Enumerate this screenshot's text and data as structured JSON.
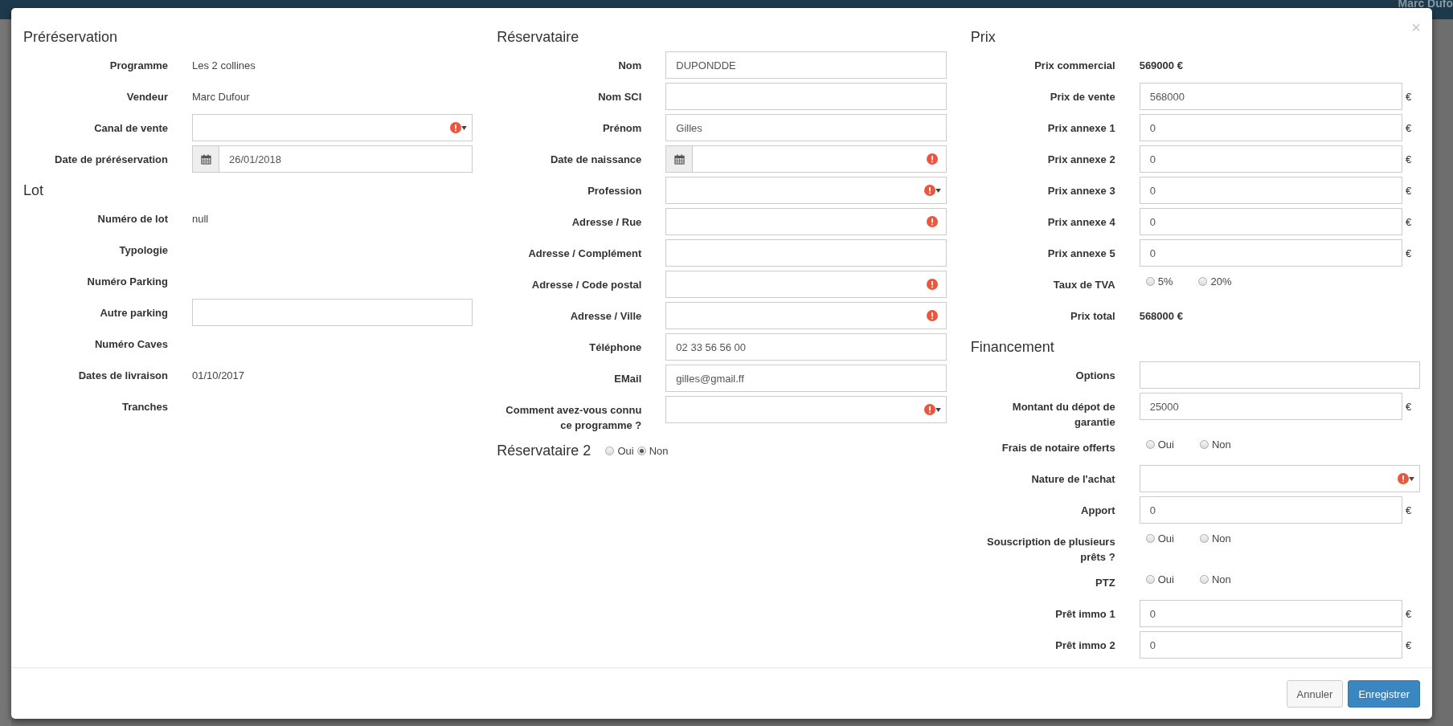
{
  "topbar": {
    "user": "Marc Dufo"
  },
  "modal": {
    "close": "×",
    "columns": [
      [
        {
          "title": "Préréservation",
          "rows": [
            {
              "kind": "static",
              "label": "Programme",
              "value": "Les 2 collines"
            },
            {
              "kind": "static",
              "label": "Vendeur",
              "value": "Marc Dufour"
            },
            {
              "kind": "select",
              "label": "Canal de vente",
              "error": true
            },
            {
              "kind": "date",
              "label": "Date de préréservation",
              "value": "26/01/2018",
              "error": false
            }
          ]
        },
        {
          "title": "Lot",
          "rows": [
            {
              "kind": "static",
              "label": "Numéro de lot",
              "value": "null"
            },
            {
              "kind": "static",
              "label": "Typologie"
            },
            {
              "kind": "static",
              "label": "Numéro Parking"
            },
            {
              "kind": "input",
              "label": "Autre parking",
              "error": false
            },
            {
              "kind": "static",
              "label": "Numéro Caves"
            },
            {
              "kind": "static",
              "label": "Dates de livraison",
              "value": "01/10/2017"
            },
            {
              "kind": "static",
              "label": "Tranches"
            }
          ]
        }
      ],
      [
        {
          "title": "Réservataire",
          "rows": [
            {
              "kind": "input",
              "label": "Nom",
              "value": "DUPONDDE",
              "error": false
            },
            {
              "kind": "input",
              "label": "Nom SCI",
              "error": false
            },
            {
              "kind": "input",
              "label": "Prénom",
              "value": "Gilles",
              "error": false
            },
            {
              "kind": "date",
              "label": "Date de naissance",
              "error": true
            },
            {
              "kind": "select",
              "label": "Profession",
              "error": true
            },
            {
              "kind": "input",
              "label": "Adresse / Rue",
              "error": true
            },
            {
              "kind": "input",
              "label": "Adresse / Complément",
              "error": false
            },
            {
              "kind": "input",
              "label": "Adresse / Code postal",
              "error": true
            },
            {
              "kind": "input",
              "label": "Adresse / Ville",
              "error": true
            },
            {
              "kind": "input",
              "label": "Téléphone",
              "value": "02 33 56 56 00",
              "error": false
            },
            {
              "kind": "input",
              "label": "EMail",
              "value": "gilles@gmail.ff",
              "error": false
            },
            {
              "kind": "select",
              "label": "Comment avez-vous connu ce programme ?",
              "error": true
            }
          ]
        },
        {
          "title": "Réservataire 2",
          "options": [
            {
              "label": "Oui",
              "selected": false
            },
            {
              "label": "Non",
              "selected": true
            }
          ]
        }
      ],
      [
        {
          "title": "Prix",
          "rows": [
            {
              "kind": "bold",
              "label": "Prix commercial",
              "value": "569000 €"
            },
            {
              "kind": "input",
              "label": "Prix de vente",
              "value": "568000",
              "suffix": "€",
              "error": false
            },
            {
              "kind": "input",
              "label": "Prix annexe 1",
              "value": "0",
              "suffix": "€",
              "error": false
            },
            {
              "kind": "input",
              "label": "Prix annexe 2",
              "value": "0",
              "suffix": "€",
              "error": false
            },
            {
              "kind": "input",
              "label": "Prix annexe 3",
              "value": "0",
              "suffix": "€",
              "error": false
            },
            {
              "kind": "input",
              "label": "Prix annexe 4",
              "value": "0",
              "suffix": "€",
              "error": false
            },
            {
              "kind": "input",
              "label": "Prix annexe 5",
              "value": "0",
              "suffix": "€",
              "error": false
            },
            {
              "kind": "radios",
              "label": "Taux de TVA",
              "options": [
                {
                  "label": "5%",
                  "selected": false
                },
                {
                  "label": "20%",
                  "selected": false
                }
              ]
            },
            {
              "kind": "bold",
              "label": "Prix total",
              "value": "568000 €"
            }
          ]
        },
        {
          "title": "Financement",
          "rows": [
            {
              "kind": "input",
              "label": "Options",
              "error": false
            },
            {
              "kind": "input",
              "label": "Montant du dépot de garantie",
              "value": "25000",
              "suffix": "€",
              "error": false
            },
            {
              "kind": "radios",
              "label": "Frais de notaire offerts",
              "options": [
                {
                  "label": "Oui",
                  "selected": false
                },
                {
                  "label": "Non",
                  "selected": false
                }
              ]
            },
            {
              "kind": "select",
              "label": "Nature de l'achat",
              "error": true
            },
            {
              "kind": "input",
              "label": "Apport",
              "value": "0",
              "suffix": "€",
              "error": false
            },
            {
              "kind": "radios",
              "label": "Souscription de plusieurs prêts ?",
              "options": [
                {
                  "label": "Oui",
                  "selected": false
                },
                {
                  "label": "Non",
                  "selected": false
                }
              ]
            },
            {
              "kind": "radios",
              "label": "PTZ",
              "options": [
                {
                  "label": "Oui",
                  "selected": false
                },
                {
                  "label": "Non",
                  "selected": false
                }
              ]
            },
            {
              "kind": "input",
              "label": "Prêt immo 1",
              "value": "0",
              "suffix": "€",
              "error": false
            },
            {
              "kind": "input",
              "label": "Prêt immo 2",
              "value": "0",
              "suffix": "€",
              "error": false
            }
          ]
        }
      ]
    ],
    "buttons": [
      {
        "label": "Annuler",
        "kind": "default"
      },
      {
        "label": "Enregistrer",
        "kind": "primary"
      }
    ]
  }
}
